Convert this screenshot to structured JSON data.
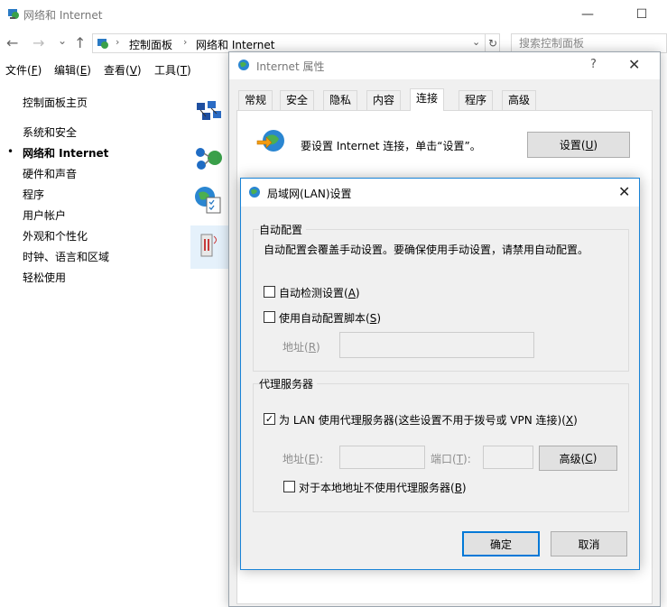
{
  "window": {
    "title": "网络和 Internet",
    "controls": {
      "minimize": "—",
      "maximize": "☐"
    }
  },
  "nav": {
    "back": "←",
    "forward": "→",
    "recent": "⌄",
    "up": "↑",
    "breadcrumb": [
      "控制面板",
      "网络和 Internet"
    ],
    "separator": "›",
    "dropdown": "⌄",
    "refresh": "↻",
    "search_placeholder": "搜索控制面板"
  },
  "menu": {
    "file": {
      "label": "文件(",
      "key": "F",
      "end": ")"
    },
    "edit": {
      "label": "编辑(",
      "key": "E",
      "end": ")"
    },
    "view": {
      "label": "查看(",
      "key": "V",
      "end": ")"
    },
    "tools": {
      "label": "工具(",
      "key": "T",
      "end": ")"
    }
  },
  "sidebar": {
    "home": "控制面板主页",
    "bullet": "•",
    "items": [
      "系统和安全",
      "网络和 Internet",
      "硬件和声音",
      "程序",
      "用户帐户",
      "外观和个性化",
      "时钟、语言和区域",
      "轻松使用"
    ],
    "active_index": 1
  },
  "category_icons": [
    "network-status-icon",
    "homegroup-icon",
    "internet-options-icon",
    "infrared-icon"
  ],
  "inet_dialog": {
    "title": "Internet 属性",
    "help": "?",
    "close": "✕",
    "tabs": [
      "常规",
      "安全",
      "隐私",
      "内容",
      "连接",
      "程序",
      "高级"
    ],
    "selected_tab": 4,
    "setup_text": "要设置 Internet 连接，单击“设置”。",
    "setup_button": {
      "label": "设置(",
      "key": "U",
      "end": ")"
    }
  },
  "lan_dialog": {
    "title": "局域网(LAN)设置",
    "close": "✕",
    "auto_config": {
      "group_label": "自动配置",
      "description": "自动配置会覆盖手动设置。要确保使用手动设置，请禁用自动配置。",
      "auto_detect": {
        "label": "自动检测设置(",
        "key": "A",
        "end": ")",
        "checked": false
      },
      "use_script": {
        "label": "使用自动配置脚本(",
        "key": "S",
        "end": ")",
        "checked": false
      },
      "address": {
        "label": "地址(",
        "key": "R",
        "end": ")",
        "value": ""
      }
    },
    "proxy": {
      "group_label": "代理服务器",
      "use_proxy": {
        "label": "为 LAN 使用代理服务器(这些设置不用于拨号或 VPN 连接)(",
        "key": "X",
        "end": ")",
        "checked": true
      },
      "address": {
        "label": "地址(",
        "key": "E",
        "end": "):",
        "value": ""
      },
      "port": {
        "label": "端口(",
        "key": "T",
        "end": "):",
        "value": ""
      },
      "advanced_button": {
        "label": "高级(",
        "key": "C",
        "end": ")"
      },
      "bypass_local": {
        "label": "对于本地地址不使用代理服务器(",
        "key": "B",
        "end": ")",
        "checked": false
      }
    },
    "ok_button": "确定",
    "cancel_button": "取消"
  },
  "colors": {
    "accent": "#0078d7",
    "dialog_bg": "#f0f0f0",
    "disabled_text": "#8d8d8d"
  }
}
